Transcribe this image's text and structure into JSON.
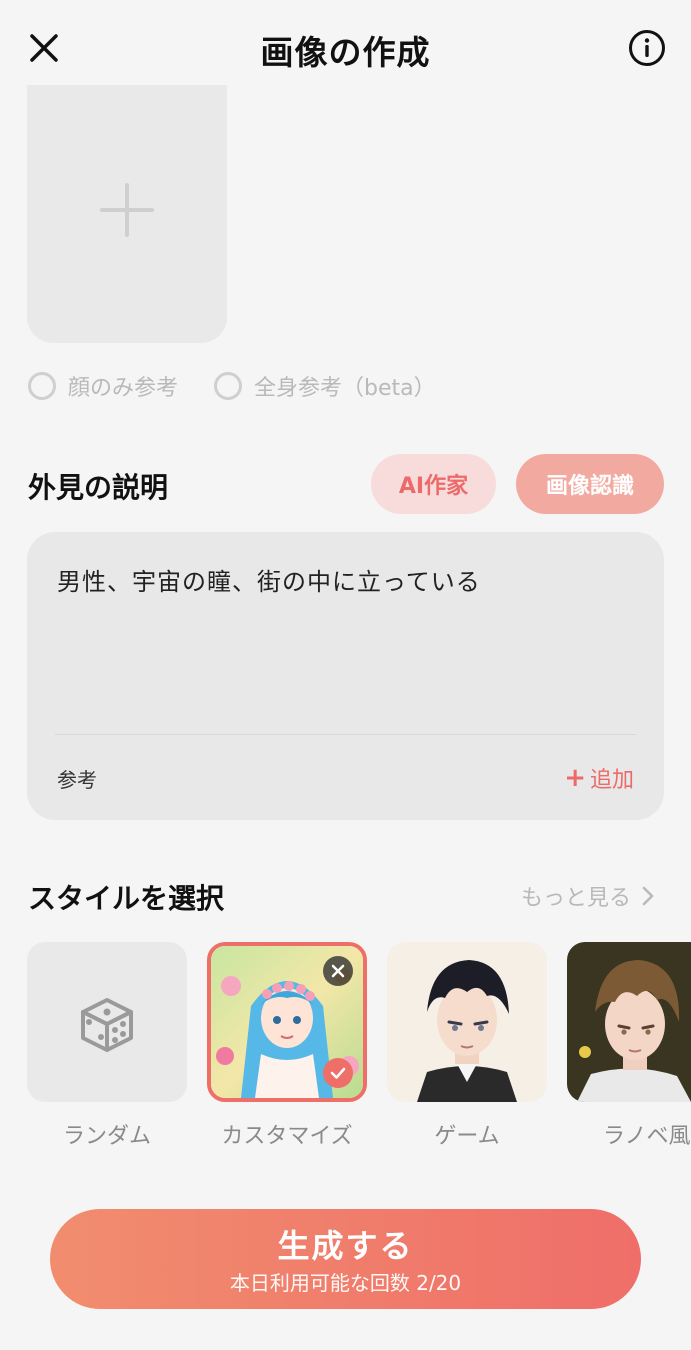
{
  "header": {
    "title": "画像の作成"
  },
  "reference": {
    "options": [
      {
        "label": "顔のみ参考"
      },
      {
        "label": "全身参考（beta）"
      }
    ]
  },
  "appearance": {
    "title": "外見の説明",
    "ai_writer_label": "AI作家",
    "image_recognition_label": "画像認識",
    "description": "男性、宇宙の瞳、街の中に立っている",
    "reference_label": "参考",
    "add_label": "追加"
  },
  "style": {
    "title": "スタイルを選択",
    "more_label": "もっと見る",
    "items": [
      {
        "label": "ランダム"
      },
      {
        "label": "カスタマイズ"
      },
      {
        "label": "ゲーム"
      },
      {
        "label": "ラノベ風"
      }
    ]
  },
  "generate": {
    "label": "生成する",
    "sub_label": "本日利用可能な回数 2/20"
  },
  "colors": {
    "accent": "#ee6f68",
    "background": "#f5f5f5",
    "card": "#e8e8e8"
  }
}
